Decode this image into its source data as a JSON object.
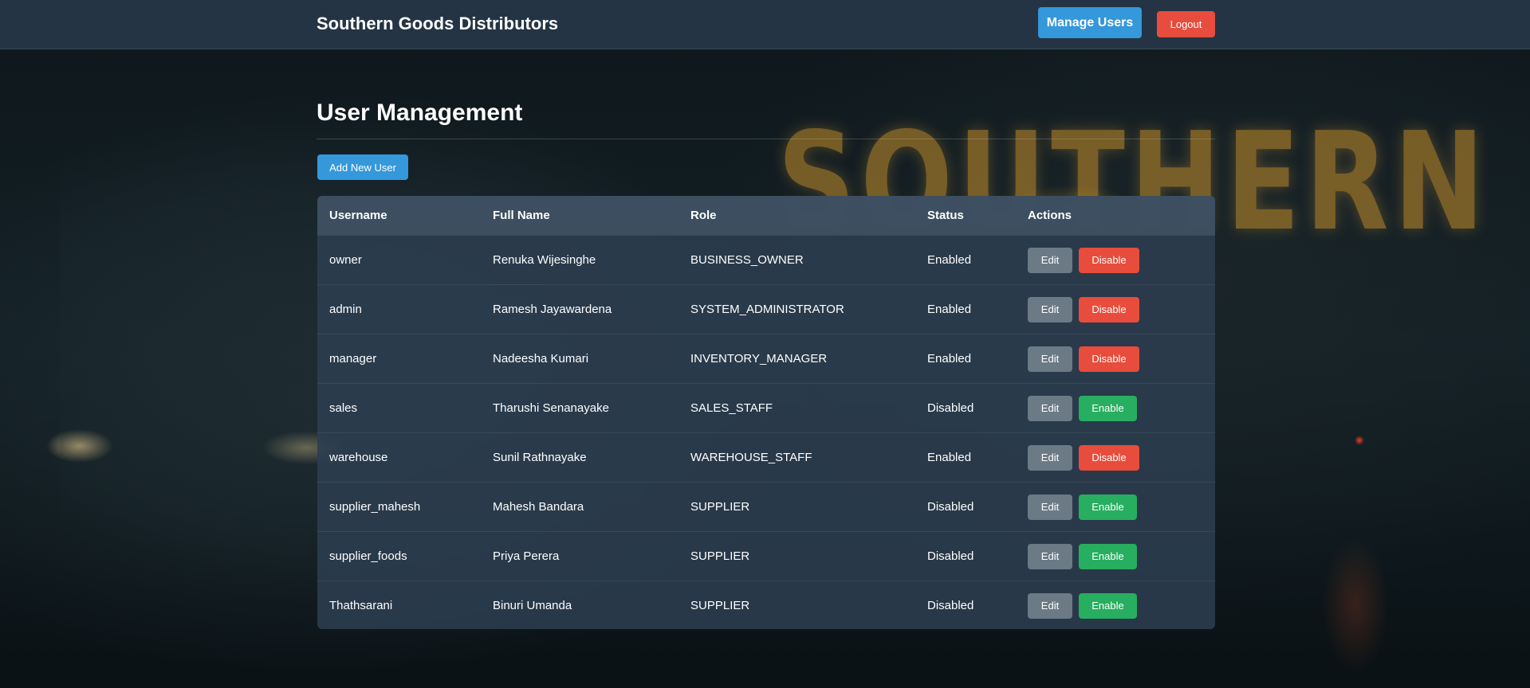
{
  "header": {
    "brand": "Southern Goods Distributors",
    "manage_users_label": "Manage Users",
    "logout_label": "Logout"
  },
  "page": {
    "title": "User Management",
    "add_user_label": "Add New User"
  },
  "background": {
    "sign_text": "SOUTHERN"
  },
  "table": {
    "columns": [
      "Username",
      "Full Name",
      "Role",
      "Status",
      "Actions"
    ],
    "edit_label": "Edit",
    "rows": [
      {
        "username": "owner",
        "full_name": "Renuka Wijesinghe",
        "role": "BUSINESS_OWNER",
        "status": "Enabled",
        "action": "Disable"
      },
      {
        "username": "admin",
        "full_name": "Ramesh Jayawardena",
        "role": "SYSTEM_ADMINISTRATOR",
        "status": "Enabled",
        "action": "Disable"
      },
      {
        "username": "manager",
        "full_name": "Nadeesha Kumari",
        "role": "INVENTORY_MANAGER",
        "status": "Enabled",
        "action": "Disable"
      },
      {
        "username": "sales",
        "full_name": "Tharushi Senanayake",
        "role": "SALES_STAFF",
        "status": "Disabled",
        "action": "Enable"
      },
      {
        "username": "warehouse",
        "full_name": "Sunil Rathnayake",
        "role": "WAREHOUSE_STAFF",
        "status": "Enabled",
        "action": "Disable"
      },
      {
        "username": "supplier_mahesh",
        "full_name": "Mahesh Bandara",
        "role": "SUPPLIER",
        "status": "Disabled",
        "action": "Enable"
      },
      {
        "username": "supplier_foods",
        "full_name": "Priya Perera",
        "role": "SUPPLIER",
        "status": "Disabled",
        "action": "Enable"
      },
      {
        "username": "Thathsarani",
        "full_name": "Binuri Umanda",
        "role": "SUPPLIER",
        "status": "Disabled",
        "action": "Enable"
      }
    ]
  },
  "colors": {
    "primary": "#3498db",
    "danger": "#e74c3c",
    "success": "#27ae60",
    "secondary": "#6c7a86",
    "header_bg": "#243444"
  }
}
